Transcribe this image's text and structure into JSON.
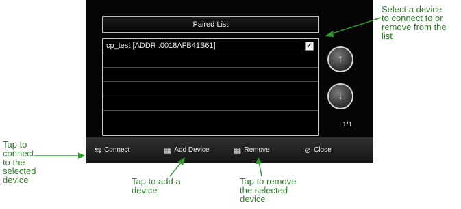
{
  "paired_list": {
    "title": "Paired List",
    "devices": [
      {
        "name": "cp_test [ADDR :0018AFB41B61]",
        "checked": true
      }
    ],
    "page": "1/1"
  },
  "scroll": {
    "up_icon": "arrow-up-icon",
    "down_icon": "arrow-down-icon"
  },
  "toolbar": {
    "connect_label": "Connect",
    "add_device_label": "Add Device",
    "remove_label": "Remove",
    "close_label": "Close",
    "icons": [
      "connect-icon",
      "add-device-icon",
      "remove-icon",
      "close-icon"
    ]
  },
  "callouts": {
    "select": "Select a device\nto connect to or\nremove from the\nlist",
    "connect": "Tap to\nconnect\nto the\nselected\ndevice",
    "add": "Tap to add a\ndevice",
    "remove": "Tap to remove\nthe selected\ndevice"
  },
  "colors": {
    "callout": "#2f7f2b",
    "screen_bg": "#050505"
  }
}
